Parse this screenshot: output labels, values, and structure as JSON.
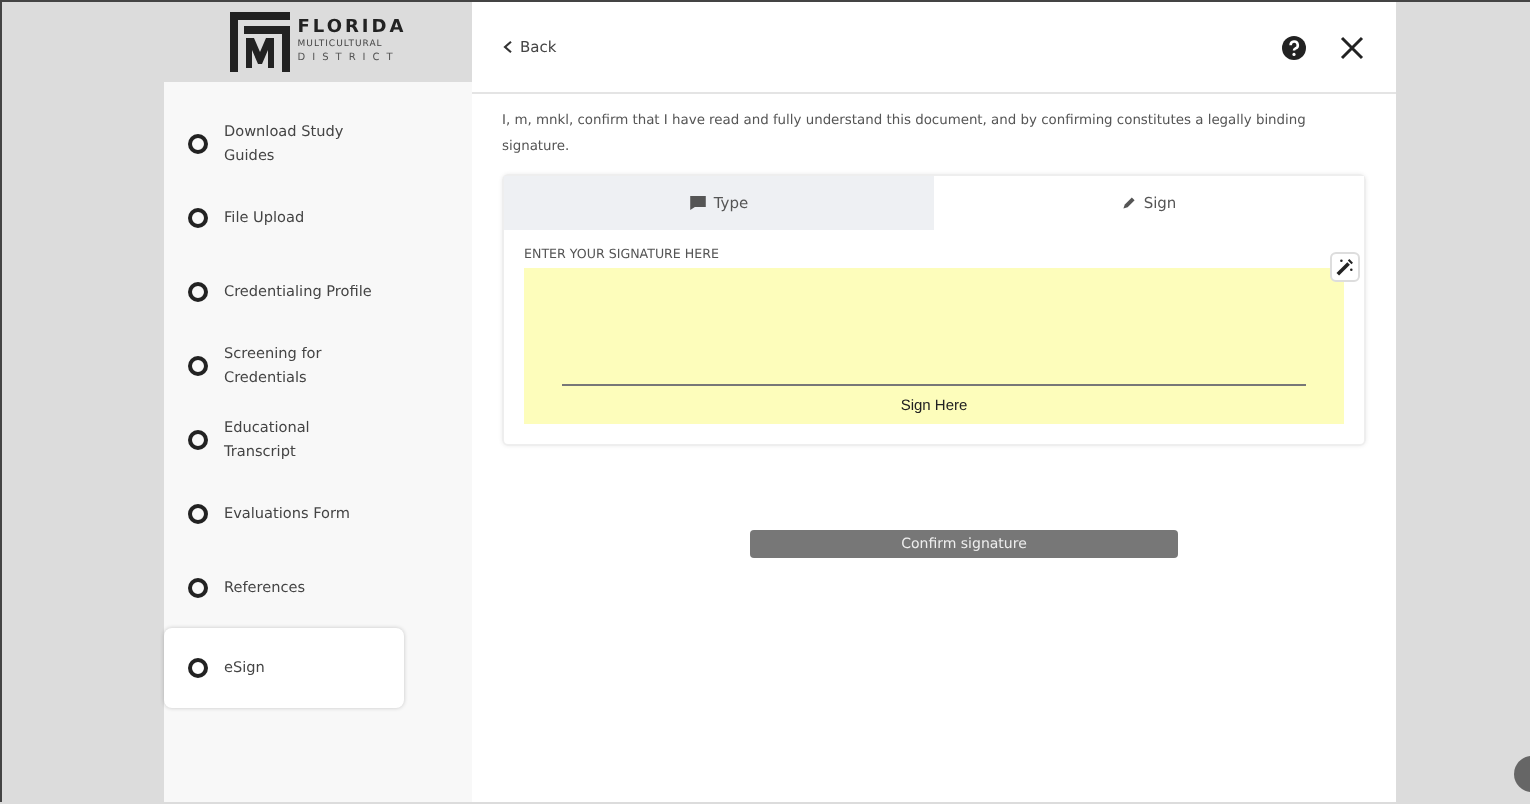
{
  "logo": {
    "line_1": "FLORIDA",
    "line_2": "MULTICULTURAL",
    "line_3": "DISTRICT"
  },
  "steps": [
    {
      "label": "Download Study Guides",
      "selected": false
    },
    {
      "label": "File Upload",
      "selected": false
    },
    {
      "label": "Credentialing Profile",
      "selected": false
    },
    {
      "label": "Screening for Credentials",
      "selected": false
    },
    {
      "label": "Educational Transcript",
      "selected": false
    },
    {
      "label": "Evaluations Form",
      "selected": false
    },
    {
      "label": "References",
      "selected": false
    },
    {
      "label": "eSign",
      "selected": true
    }
  ],
  "header": {
    "back": "Back"
  },
  "statement": "I, m, mnkl, confirm that I have read and fully understand this document, and by confirming constitutes a legally binding signature.",
  "tabs": [
    {
      "label": "Type",
      "kind": "type",
      "selected": false
    },
    {
      "label": "Sign",
      "kind": "sign",
      "selected": true
    }
  ],
  "pad": {
    "label": "ENTER YOUR SIGNATURE HERE",
    "line_caption": "Sign Here"
  },
  "confirm": {
    "label": "Confirm signature",
    "disabled": true
  }
}
